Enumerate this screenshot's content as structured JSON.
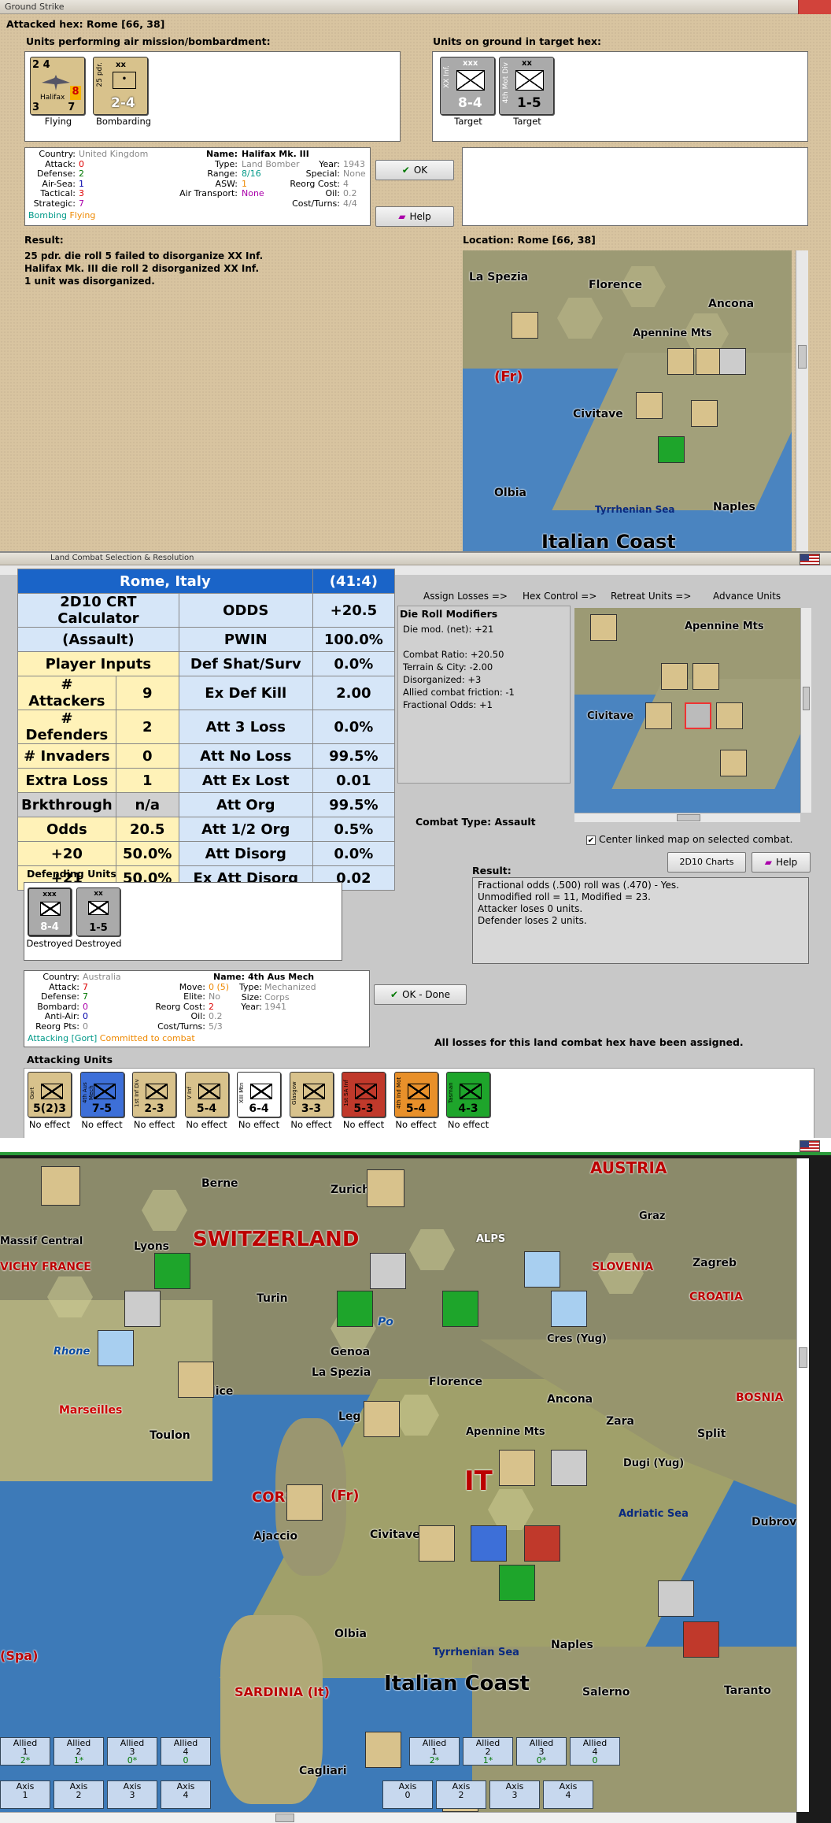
{
  "ground_strike": {
    "window_title": "Ground Strike",
    "attacked_hex": "Attacked hex: Rome [66, 38]",
    "units_air_label": "Units performing air mission/bombardment:",
    "units_ground_label": "Units on ground in target hex:",
    "air_units": [
      {
        "name": "Halifax",
        "values": "2  4",
        "bottom": "3        7",
        "badge": "8",
        "caption": "Flying"
      },
      {
        "name": "25 pdr.",
        "size": "xx",
        "values": "2-4",
        "caption": "Bombarding"
      }
    ],
    "ground_units": [
      {
        "name": "XX Inf.",
        "size": "xxx",
        "values": "8-4",
        "caption": "Target"
      },
      {
        "name": "4th Mot Div",
        "size": "xx",
        "values": "1-5",
        "caption": "Target"
      }
    ],
    "unit_info": {
      "country_k": "Country:",
      "country_v": "United Kingdom",
      "attack_k": "Attack:",
      "attack_v": "0",
      "defense_k": "Defense:",
      "defense_v": "2",
      "airsea_k": "Air-Sea:",
      "airsea_v": "1",
      "tactical_k": "Tactical:",
      "tactical_v": "3",
      "strategic_k": "Strategic:",
      "strategic_v": "7",
      "status1": "Bombing",
      "status2": "Flying",
      "name_k": "Name:",
      "name_v": "Halifax Mk. III",
      "type_k": "Type:",
      "type_v": "Land Bomber",
      "year_k": "Year:",
      "year_v": "1943",
      "range_k": "Range:",
      "range_v": "8/16",
      "special_k": "Special:",
      "special_v": "None",
      "asw_k": "ASW:",
      "asw_v": "1",
      "reorg_k": "Reorg Cost:",
      "reorg_v": "4",
      "airtrans_k": "Air Transport:",
      "airtrans_v": "None",
      "oil_k": "Oil:",
      "oil_v": "0.2",
      "cost_k": "Cost/Turns:",
      "cost_v": "4/4"
    },
    "ok_label": "OK",
    "help_label": "Help",
    "result_label": "Result:",
    "result_lines": [
      "25 pdr. die roll 5 failed to disorganize XX Inf.",
      "Halifax Mk. III die roll 2 disorganized XX Inf.",
      "1 unit was disorganized."
    ],
    "location_label": "Location:  Rome  [66, 38]"
  },
  "land_combat": {
    "window_title": "Land Combat Selection & Resolution",
    "tabs": [
      "Assign Losses =>",
      "Hex Control =>",
      "Retreat Units =>",
      "Advance Units"
    ],
    "crt": {
      "header_left": "Rome, Italy",
      "header_right": "(41:4)",
      "rows": [
        [
          "2D10 CRT Calculator",
          "",
          "ODDS",
          "+20.5"
        ],
        [
          "(Assault)",
          "",
          "PWIN",
          "100.0%"
        ],
        [
          "Player Inputs",
          "",
          "Def Shat/Surv",
          "0.0%"
        ],
        [
          "# Attackers",
          "9",
          "Ex Def Kill",
          "2.00"
        ],
        [
          "# Defenders",
          "2",
          "Att 3 Loss",
          "0.0%"
        ],
        [
          "# Invaders",
          "0",
          "Att No Loss",
          "99.5%"
        ],
        [
          "Extra Loss",
          "1",
          "Att Ex Lost",
          "0.01"
        ],
        [
          "Brkthrough",
          "n/a",
          "Att Org",
          "99.5%"
        ],
        [
          "Odds",
          "20.5",
          "Att 1/2 Org",
          "0.5%"
        ],
        [
          "+20",
          "50.0%",
          "Att Disorg",
          "0.0%"
        ],
        [
          "+21",
          "50.0%",
          "Ex Att Disorg",
          "0.02"
        ]
      ]
    },
    "die_roll_title": "Die Roll Modifiers",
    "die_roll_lines": [
      "Die mod. (net): +21",
      "",
      "Combat Ratio: +20.50",
      "Terrain & City: -2.00",
      "Disorganized: +3",
      "Allied combat friction: -1",
      "Fractional Odds: +1"
    ],
    "combat_type": "Combat Type:  Assault",
    "center_linked": "Center linked map on selected combat.",
    "charts_label": "2D10 Charts",
    "help_label": "Help",
    "result_label": "Result:",
    "result_lines": [
      "Fractional odds (.500) roll was (.470)  -  Yes.",
      "Unmodified roll = 11, Modified = 23.",
      "Attacker loses 0 units.",
      "Defender loses 2 units."
    ],
    "defending_label": "Defending Units",
    "defenders": [
      {
        "name": "XX Inf.",
        "size": "xxx",
        "values": "8-4",
        "caption": "Destroyed"
      },
      {
        "name": "4th Mot Div",
        "size": "xx",
        "values": "1-5",
        "caption": "Destroyed"
      }
    ],
    "unit_info": {
      "country_k": "Country:",
      "country_v": "Australia",
      "attack_k": "Attack:",
      "attack_v": "7",
      "defense_k": "Defense:",
      "defense_v": "7",
      "bombard_k": "Bombard:",
      "bombard_v": "0",
      "antiair_k": "Anti-Air:",
      "antiair_v": "0",
      "reorgpts_k": "Reorg Pts:",
      "reorgpts_v": "0",
      "status1": "Attacking [Gort]",
      "status2": "Committed to combat",
      "name_k": "Name:",
      "name_v": "4th Aus Mech",
      "move_k": "Move:",
      "move_v": "0 (5)",
      "type_k": "Type:",
      "type_v": "Mechanized",
      "elite_k": "Elite:",
      "elite_v": "No",
      "size_k": "Size:",
      "size_v": "Corps",
      "reorg_k": "Reorg Cost:",
      "reorg_v": "2",
      "year_k": "Year:",
      "year_v": "1941",
      "oil_k": "Oil:",
      "oil_v": "0.2",
      "cost_k": "Cost/Turns:",
      "cost_v": "5/3"
    },
    "ok_done_label": "OK - Done",
    "all_losses": "All losses for this land combat hex have been assigned.",
    "attacking_label": "Attacking Units",
    "attackers": [
      {
        "name": "Gort",
        "values": "5(2)3",
        "color": "#d8c28c",
        "caption": "No effect"
      },
      {
        "name": "4th Aus Mech",
        "values": "7-5",
        "color": "#3d6fd8",
        "caption": "No effect"
      },
      {
        "name": "1st Inf Div",
        "values": "2-3",
        "color": "#d8c28c",
        "caption": "No effect"
      },
      {
        "name": "V Inf",
        "values": "5-4",
        "color": "#d8c28c",
        "caption": "No effect"
      },
      {
        "name": "XIII Mtn",
        "values": "6-4",
        "color": "#ffffff",
        "caption": "No effect"
      },
      {
        "name": "Glasgow",
        "values": "3-3",
        "color": "#d8c28c",
        "caption": "No effect"
      },
      {
        "name": "1st SA Inf",
        "values": "5-3",
        "color": "#c0392b",
        "caption": "No effect"
      },
      {
        "name": "4th Ind Mot",
        "values": "5-4",
        "color": "#e8902a",
        "caption": "No effect"
      },
      {
        "name": "Tasman",
        "values": "4-3",
        "color": "#1ea52b",
        "caption": "No effect"
      }
    ]
  },
  "main_map": {
    "labels": {
      "austria": "AUSTRIA",
      "switzerland": "SWITZERLAND",
      "alps": "ALPS",
      "berne": "Berne",
      "zurich": "Zurich",
      "graz": "Graz",
      "zagreb": "Zagreb",
      "slovenia": "SLOVENIA",
      "croatia": "CROATIA",
      "lyons": "Lyons",
      "vichy": "VICHY FRANCE",
      "massif": "Massif Central",
      "turin": "Turin",
      "genoa": "Genoa",
      "po": "Po",
      "cres": "Cres (Yug)",
      "rhone": "Rhone",
      "marseilles": "Marseilles",
      "toulon": "Toulon",
      "nice": "Nice",
      "laspezia": "La Spezia",
      "florence": "Florence",
      "ancona": "Ancona",
      "zara": "Zara",
      "bosnia": "BOSNIA",
      "split": "Split",
      "dugi": "Dugi (Yug)",
      "apennine": "Apennine Mts",
      "corsica": "CORSICA",
      "fr": "(Fr)",
      "ajaccio": "Ajaccio",
      "civitave": "Civitave",
      "it": "IT",
      "adriatic": "Adriatic Sea",
      "dubrov": "Dubrov",
      "olbia": "Olbia",
      "tyrrhenian": "Tyrrhenian Sea",
      "naples": "Naples",
      "spa": "(Spa)",
      "sardinia": "SARDINIA (It)",
      "italian_coast": "Italian Coast",
      "salerno": "Salerno",
      "taranto": "Taranto",
      "cagliari": "Cagliari",
      "leg": "Leg"
    },
    "allied_boxes": [
      {
        "side": "Allied",
        "n": "1",
        "v": "2*"
      },
      {
        "side": "Allied",
        "n": "2",
        "v": "1*"
      },
      {
        "side": "Allied",
        "n": "3",
        "v": "0*"
      },
      {
        "side": "Allied",
        "n": "4",
        "v": "0"
      }
    ],
    "allied_boxes_right": [
      {
        "side": "Allied",
        "n": "1",
        "v": "2*"
      },
      {
        "side": "Allied",
        "n": "2",
        "v": "1*"
      },
      {
        "side": "Allied",
        "n": "3",
        "v": "0*"
      },
      {
        "side": "Allied",
        "n": "4",
        "v": "0"
      }
    ],
    "axis_boxes": [
      {
        "side": "Axis",
        "n": "1"
      },
      {
        "side": "Axis",
        "n": "2"
      },
      {
        "side": "Axis",
        "n": "3"
      },
      {
        "side": "Axis",
        "n": "4"
      }
    ],
    "axis_boxes_right": [
      {
        "side": "Axis",
        "n": "0"
      },
      {
        "side": "Axis",
        "n": "2"
      },
      {
        "side": "Axis",
        "n": "3"
      },
      {
        "side": "Axis",
        "n": "4"
      }
    ]
  }
}
